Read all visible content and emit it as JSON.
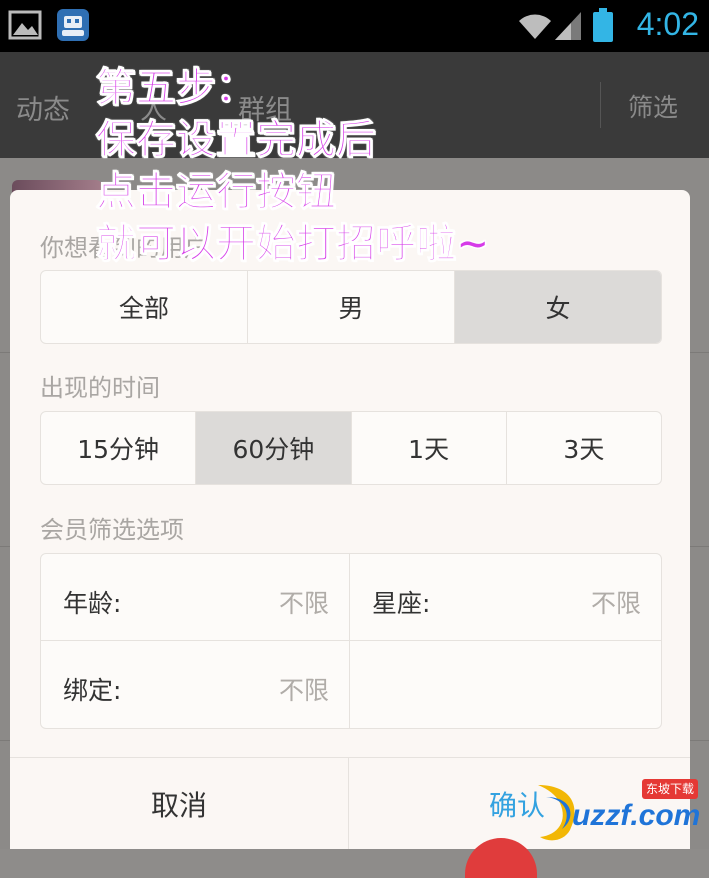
{
  "status_bar": {
    "time": "4:02",
    "icons": [
      "gallery-icon",
      "robot-app-icon",
      "wifi-icon",
      "signal-icon",
      "battery-icon"
    ]
  },
  "app_bar": {
    "tabs": [
      "动态",
      "人",
      "群组"
    ],
    "filter_label": "筛选"
  },
  "dialog": {
    "gender_title": "你想看到的用户",
    "gender_options": [
      "全部",
      "男",
      "女"
    ],
    "gender_selected": "女",
    "time_title": "出现的时间",
    "time_options": [
      "15分钟",
      "60分钟",
      "1天",
      "3天"
    ],
    "time_selected": "60分钟",
    "member_title": "会员筛选选项",
    "age_label": "年龄:",
    "age_value": "不限",
    "zodiac_label": "星座:",
    "zodiac_value": "不限",
    "binding_label": "绑定:",
    "binding_value": "不限",
    "cancel_label": "取消",
    "confirm_label": "确认"
  },
  "overlay_lines": [
    "第五步：",
    "保存设置完成后",
    "点击运行按钮",
    "就可以开始打招呼啦~"
  ],
  "watermark": {
    "text": "uzzf.com",
    "badge": "东坡下载"
  },
  "colors": {
    "accent": "#33b5e5",
    "overlay_text": "#d63be8",
    "selected_segment": "#dcdad8",
    "confirm": "#33a2e0"
  }
}
